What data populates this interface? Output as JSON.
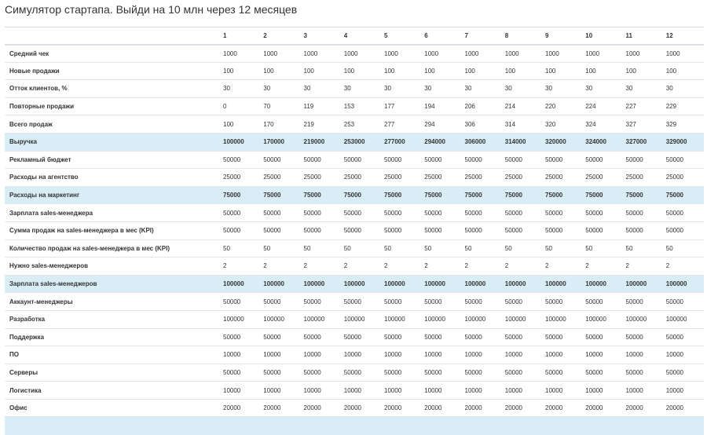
{
  "title": "Симулятор стартапа. Выйди на 10 млн через 12 месяцев",
  "table": {
    "header": [
      "",
      "1",
      "2",
      "3",
      "4",
      "5",
      "6",
      "7",
      "8",
      "9",
      "10",
      "11",
      "12"
    ],
    "rows": [
      {
        "label": "Средний чек",
        "highlight": false,
        "values": [
          "1000",
          "1000",
          "1000",
          "1000",
          "1000",
          "1000",
          "1000",
          "1000",
          "1000",
          "1000",
          "1000",
          "1000"
        ]
      },
      {
        "label": "Новые продажи",
        "highlight": false,
        "values": [
          "100",
          "100",
          "100",
          "100",
          "100",
          "100",
          "100",
          "100",
          "100",
          "100",
          "100",
          "100"
        ]
      },
      {
        "label": "Отток клиентов, %",
        "highlight": false,
        "values": [
          "30",
          "30",
          "30",
          "30",
          "30",
          "30",
          "30",
          "30",
          "30",
          "30",
          "30",
          "30"
        ]
      },
      {
        "label": "Повторные продажи",
        "highlight": false,
        "values": [
          "0",
          "70",
          "119",
          "153",
          "177",
          "194",
          "206",
          "214",
          "220",
          "224",
          "227",
          "229"
        ]
      },
      {
        "label": "Всего продаж",
        "highlight": false,
        "values": [
          "100",
          "170",
          "219",
          "253",
          "277",
          "294",
          "306",
          "314",
          "320",
          "324",
          "327",
          "329"
        ]
      },
      {
        "label": "Выручка",
        "highlight": true,
        "values": [
          "100000",
          "170000",
          "219000",
          "253000",
          "277000",
          "294000",
          "306000",
          "314000",
          "320000",
          "324000",
          "327000",
          "329000"
        ]
      },
      {
        "label": "Рекламный бюджет",
        "highlight": false,
        "values": [
          "50000",
          "50000",
          "50000",
          "50000",
          "50000",
          "50000",
          "50000",
          "50000",
          "50000",
          "50000",
          "50000",
          "50000"
        ]
      },
      {
        "label": "Расходы на агентство",
        "highlight": false,
        "values": [
          "25000",
          "25000",
          "25000",
          "25000",
          "25000",
          "25000",
          "25000",
          "25000",
          "25000",
          "25000",
          "25000",
          "25000"
        ]
      },
      {
        "label": "Расходы на маркетинг",
        "highlight": true,
        "values": [
          "75000",
          "75000",
          "75000",
          "75000",
          "75000",
          "75000",
          "75000",
          "75000",
          "75000",
          "75000",
          "75000",
          "75000"
        ]
      },
      {
        "label": "Зарплата sales-менеджера",
        "highlight": false,
        "values": [
          "50000",
          "50000",
          "50000",
          "50000",
          "50000",
          "50000",
          "50000",
          "50000",
          "50000",
          "50000",
          "50000",
          "50000"
        ]
      },
      {
        "label": "Сумма продаж на sales-менеджера в мес (KPI)",
        "highlight": false,
        "values": [
          "50000",
          "50000",
          "50000",
          "50000",
          "50000",
          "50000",
          "50000",
          "50000",
          "50000",
          "50000",
          "50000",
          "50000"
        ]
      },
      {
        "label": "Количество продаж на sales-менеджера в мес (KPI)",
        "highlight": false,
        "values": [
          "50",
          "50",
          "50",
          "50",
          "50",
          "50",
          "50",
          "50",
          "50",
          "50",
          "50",
          "50"
        ]
      },
      {
        "label": "Нужно sales-менеджеров",
        "highlight": false,
        "values": [
          "2",
          "2",
          "2",
          "2",
          "2",
          "2",
          "2",
          "2",
          "2",
          "2",
          "2",
          "2"
        ]
      },
      {
        "label": "Зарплата sales-менеджеров",
        "highlight": true,
        "values": [
          "100000",
          "100000",
          "100000",
          "100000",
          "100000",
          "100000",
          "100000",
          "100000",
          "100000",
          "100000",
          "100000",
          "100000"
        ]
      },
      {
        "label": "Аккаунт-менеджеры",
        "highlight": false,
        "values": [
          "50000",
          "50000",
          "50000",
          "50000",
          "50000",
          "50000",
          "50000",
          "50000",
          "50000",
          "50000",
          "50000",
          "50000"
        ]
      },
      {
        "label": "Разработка",
        "highlight": false,
        "values": [
          "100000",
          "100000",
          "100000",
          "100000",
          "100000",
          "100000",
          "100000",
          "100000",
          "100000",
          "100000",
          "100000",
          "100000"
        ]
      },
      {
        "label": "Поддержка",
        "highlight": false,
        "values": [
          "50000",
          "50000",
          "50000",
          "50000",
          "50000",
          "50000",
          "50000",
          "50000",
          "50000",
          "50000",
          "50000",
          "50000"
        ]
      },
      {
        "label": "ПО",
        "highlight": false,
        "values": [
          "10000",
          "10000",
          "10000",
          "10000",
          "10000",
          "10000",
          "10000",
          "10000",
          "10000",
          "10000",
          "10000",
          "10000"
        ]
      },
      {
        "label": "Серверы",
        "highlight": false,
        "values": [
          "50000",
          "50000",
          "50000",
          "50000",
          "50000",
          "50000",
          "50000",
          "50000",
          "50000",
          "50000",
          "50000",
          "50000"
        ]
      },
      {
        "label": "Логистика",
        "highlight": false,
        "values": [
          "10000",
          "10000",
          "10000",
          "10000",
          "10000",
          "10000",
          "10000",
          "10000",
          "10000",
          "10000",
          "10000",
          "10000"
        ]
      },
      {
        "label": "Офис",
        "highlight": false,
        "values": [
          "20000",
          "20000",
          "20000",
          "20000",
          "20000",
          "20000",
          "20000",
          "20000",
          "20000",
          "20000",
          "20000",
          "20000"
        ]
      }
    ]
  },
  "colors": {
    "highlight_row": "#d9edf7",
    "border": "#e3e6ea",
    "text": "#333333"
  }
}
